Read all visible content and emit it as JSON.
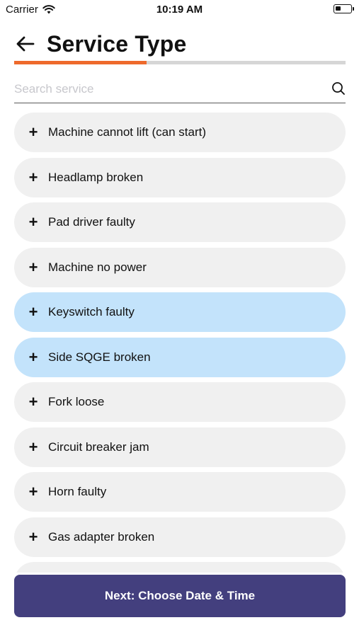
{
  "status_bar": {
    "carrier": "Carrier",
    "time": "10:19 AM",
    "battery_level": 0.35
  },
  "header": {
    "title": "Service Type"
  },
  "progress": {
    "fraction": 0.4
  },
  "search": {
    "placeholder": "Search service",
    "value": ""
  },
  "services": [
    {
      "label": "Machine cannot lift (can start)",
      "selected": false
    },
    {
      "label": "Headlamp broken",
      "selected": false
    },
    {
      "label": "Pad driver faulty",
      "selected": false
    },
    {
      "label": "Machine no power",
      "selected": false
    },
    {
      "label": "Keyswitch faulty",
      "selected": true
    },
    {
      "label": "Side SQGE broken",
      "selected": true
    },
    {
      "label": "Fork loose",
      "selected": false
    },
    {
      "label": "Circuit breaker jam",
      "selected": false
    },
    {
      "label": "Horn faulty",
      "selected": false
    },
    {
      "label": "Gas adapter broken",
      "selected": false
    },
    {
      "label": "",
      "selected": false
    }
  ],
  "add_symbol": "+",
  "next_button": {
    "label": "Next: Choose Date & Time"
  },
  "colors": {
    "accent": "#ee6a2c",
    "primary": "#433f7e",
    "selected_item": "#c3e3fb",
    "item": "#f0f0f0"
  }
}
